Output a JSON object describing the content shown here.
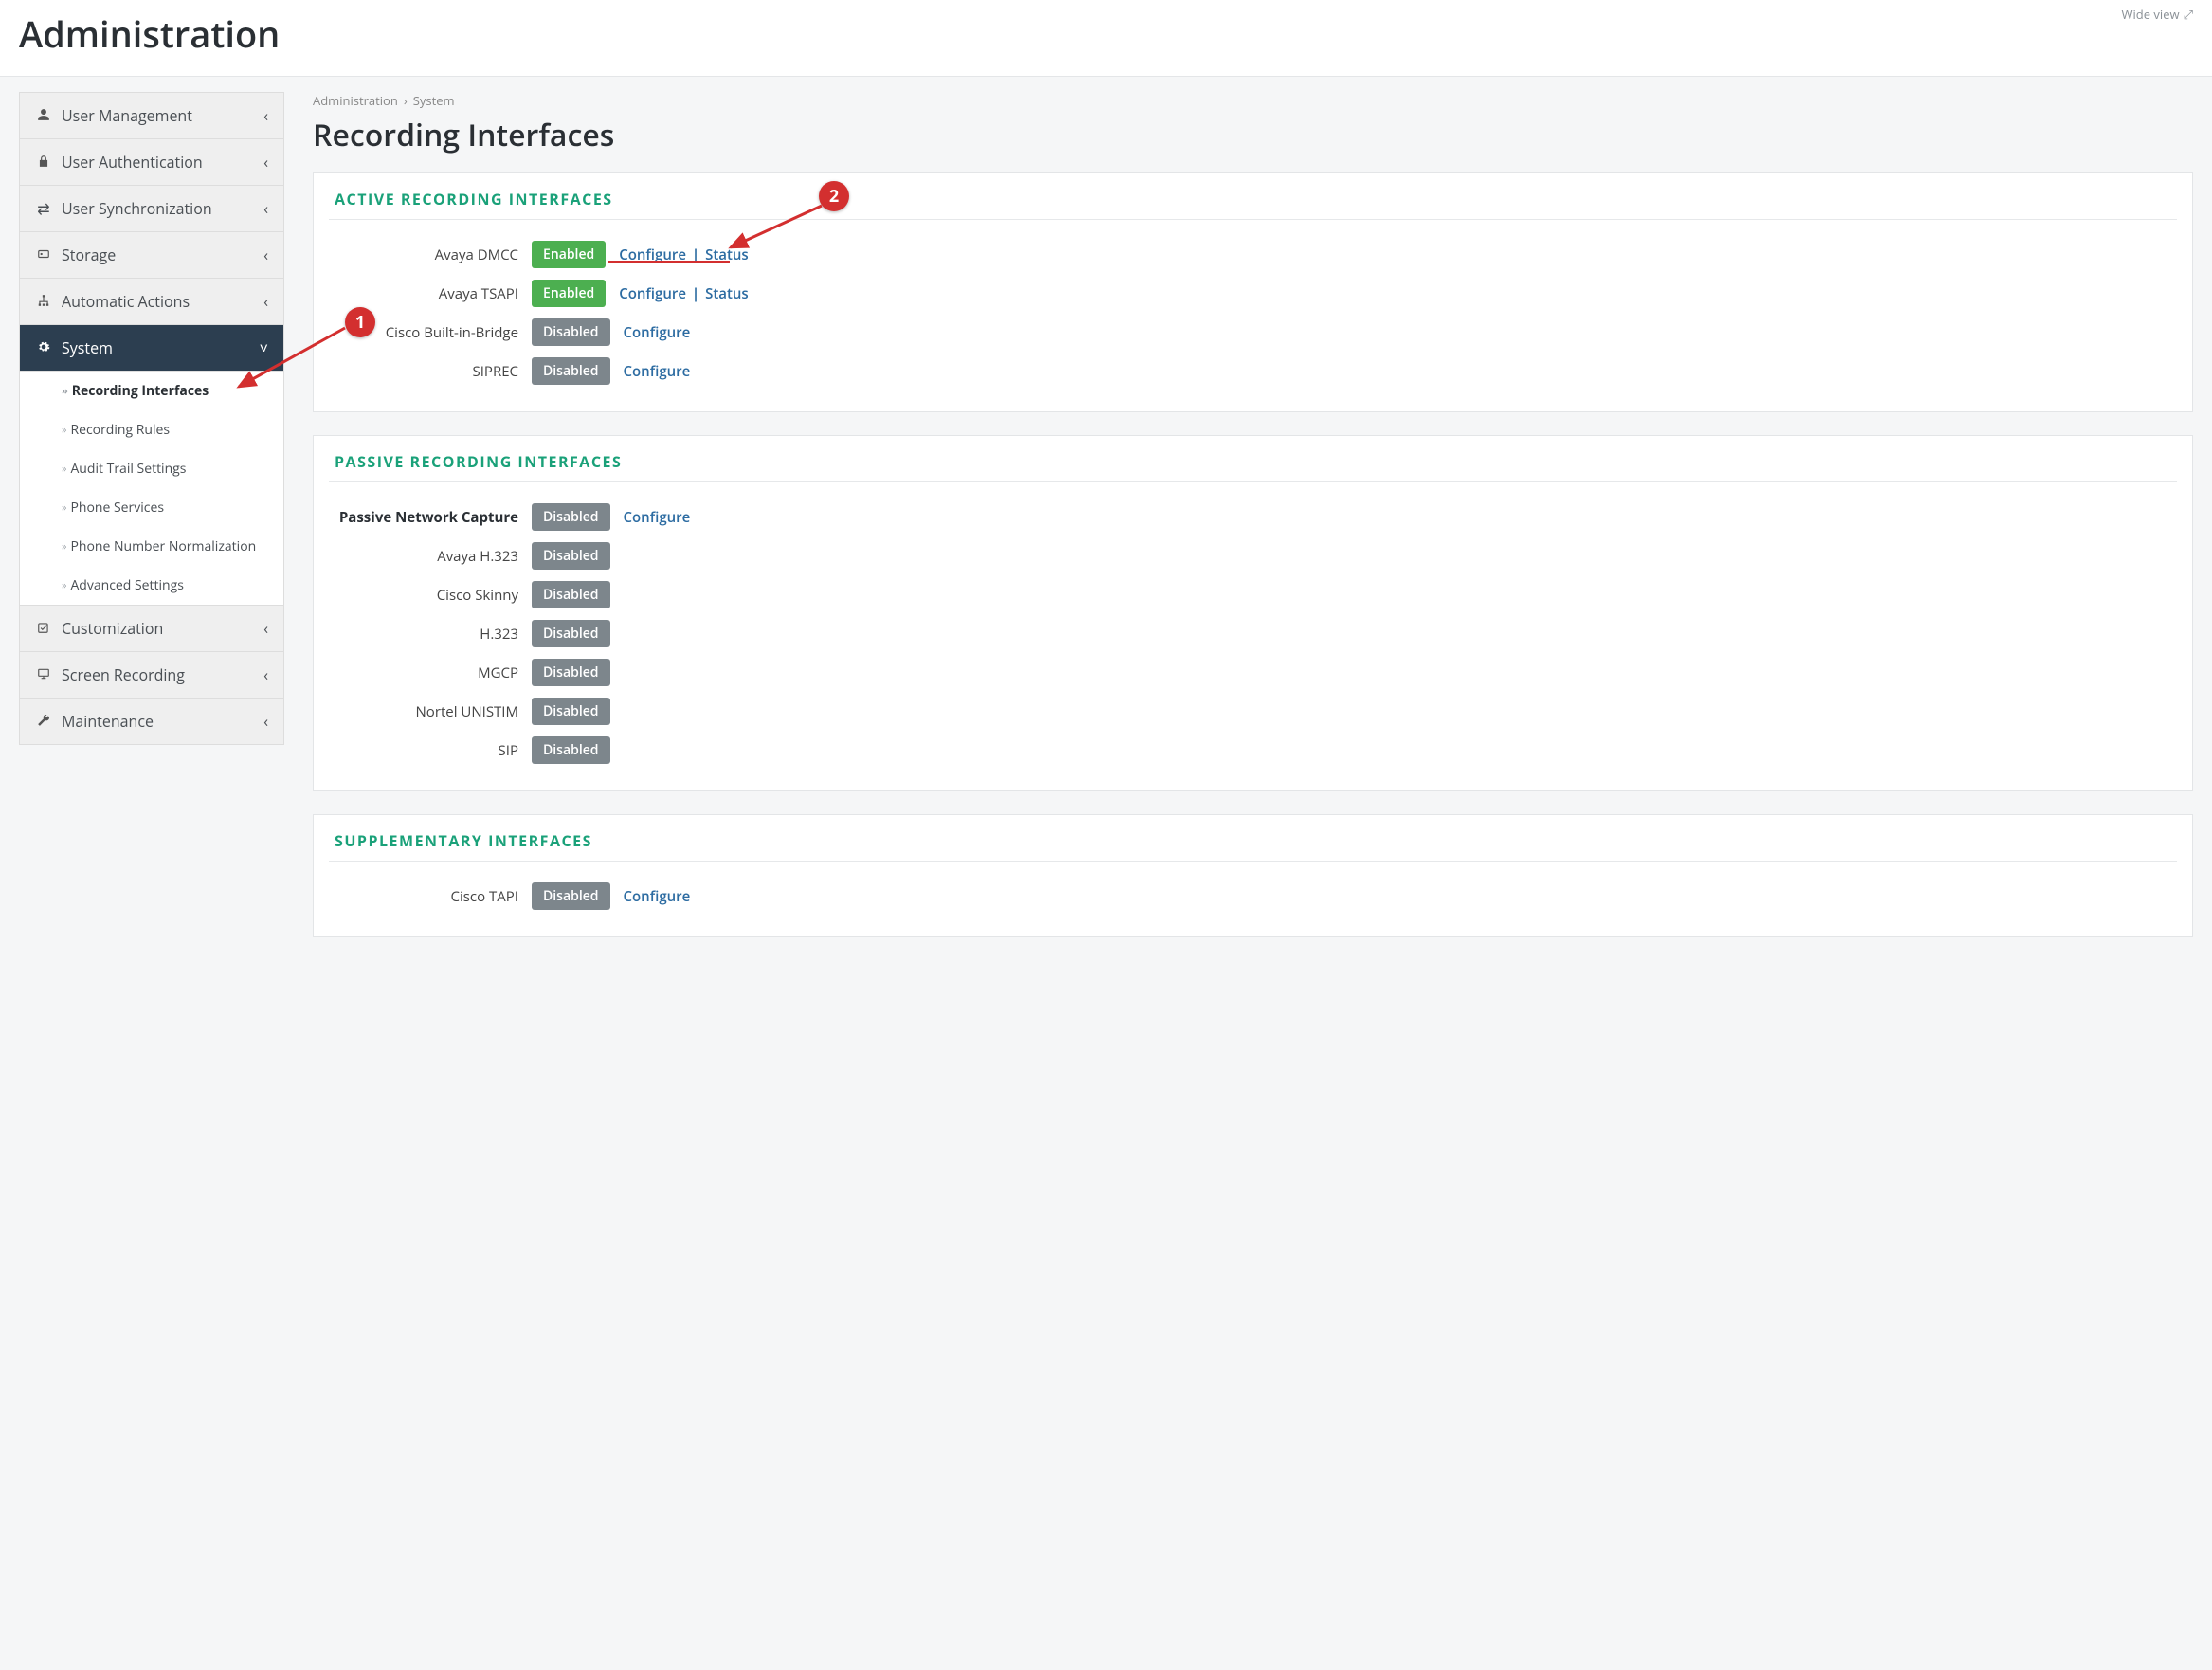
{
  "header": {
    "title": "Administration",
    "wide_view": "Wide view"
  },
  "breadcrumb": {
    "root": "Administration",
    "leaf": "System"
  },
  "page_title": "Recording Interfaces",
  "sidebar": {
    "items": [
      {
        "label": "User Management"
      },
      {
        "label": "User Authentication"
      },
      {
        "label": "User Synchronization"
      },
      {
        "label": "Storage"
      },
      {
        "label": "Automatic Actions"
      },
      {
        "label": "System"
      },
      {
        "label": "Customization"
      },
      {
        "label": "Screen Recording"
      },
      {
        "label": "Maintenance"
      }
    ],
    "system_sub": [
      {
        "label": "Recording Interfaces"
      },
      {
        "label": "Recording Rules"
      },
      {
        "label": "Audit Trail Settings"
      },
      {
        "label": "Phone Services"
      },
      {
        "label": "Phone Number Normalization"
      },
      {
        "label": "Advanced Settings"
      }
    ]
  },
  "links": {
    "configure": "Configure",
    "status": "Status"
  },
  "badges": {
    "enabled": "Enabled",
    "disabled": "Disabled"
  },
  "panels": {
    "active": {
      "title": "ACTIVE  RECORDING  INTERFACES",
      "rows": [
        {
          "label": "Avaya DMCC"
        },
        {
          "label": "Avaya TSAPI"
        },
        {
          "label": "Cisco Built-in-Bridge"
        },
        {
          "label": "SIPREC"
        }
      ]
    },
    "passive": {
      "title": "PASSIVE  RECORDING  INTERFACES",
      "rows": [
        {
          "label": "Passive Network Capture"
        },
        {
          "label": "Avaya H.323"
        },
        {
          "label": "Cisco Skinny"
        },
        {
          "label": "H.323"
        },
        {
          "label": "MGCP"
        },
        {
          "label": "Nortel UNISTIM"
        },
        {
          "label": "SIP"
        }
      ]
    },
    "supplementary": {
      "title": "SUPPLEMENTARY  INTERFACES",
      "rows": [
        {
          "label": "Cisco TAPI"
        }
      ]
    }
  },
  "annotations": {
    "b1": "1",
    "b2": "2"
  }
}
